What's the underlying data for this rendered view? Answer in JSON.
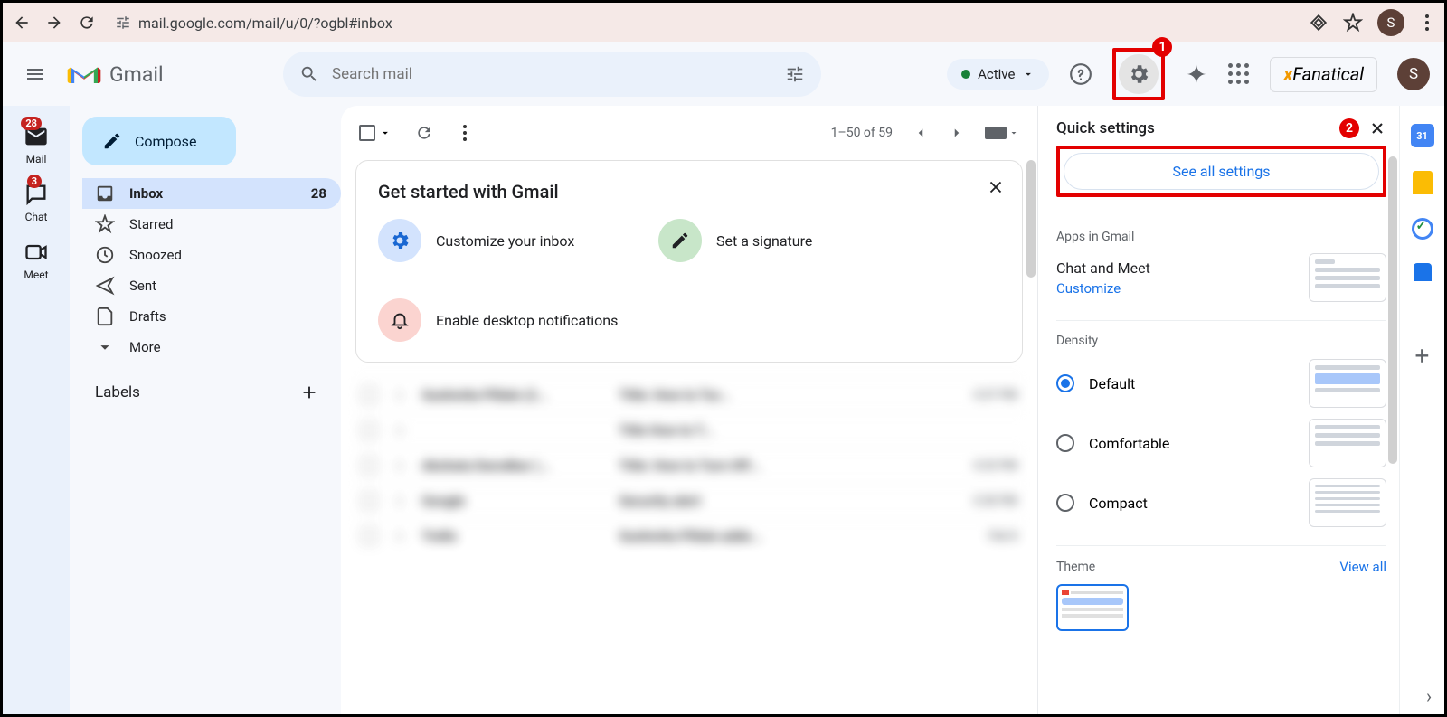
{
  "browser": {
    "url": "mail.google.com/mail/u/0/?ogbl#inbox",
    "avatar_letter": "S"
  },
  "header": {
    "app_name": "Gmail",
    "search_placeholder": "Search mail",
    "status": "Active",
    "extension": "Fanatical",
    "avatar_letter": "S",
    "callout_1": "1"
  },
  "rail": {
    "mail": {
      "label": "Mail",
      "badge": "28"
    },
    "chat": {
      "label": "Chat",
      "badge": "3"
    },
    "meet": {
      "label": "Meet"
    }
  },
  "sidebar": {
    "compose": "Compose",
    "items": [
      {
        "label": "Inbox",
        "count": "28"
      },
      {
        "label": "Starred"
      },
      {
        "label": "Snoozed"
      },
      {
        "label": "Sent"
      },
      {
        "label": "Drafts"
      },
      {
        "label": "More"
      }
    ],
    "labels_header": "Labels"
  },
  "toolbar": {
    "page_info": "1–50 of 59"
  },
  "get_started": {
    "title": "Get started with Gmail",
    "customize": "Customize your inbox",
    "signature": "Set a signature",
    "notifications": "Enable desktop notifications"
  },
  "quick_settings": {
    "title": "Quick settings",
    "callout_2": "2",
    "see_all": "See all settings",
    "apps_label": "Apps in Gmail",
    "chat_meet": "Chat and Meet",
    "customize": "Customize",
    "density_label": "Density",
    "density_options": [
      "Default",
      "Comfortable",
      "Compact"
    ],
    "theme_label": "Theme",
    "view_all": "View all"
  }
}
